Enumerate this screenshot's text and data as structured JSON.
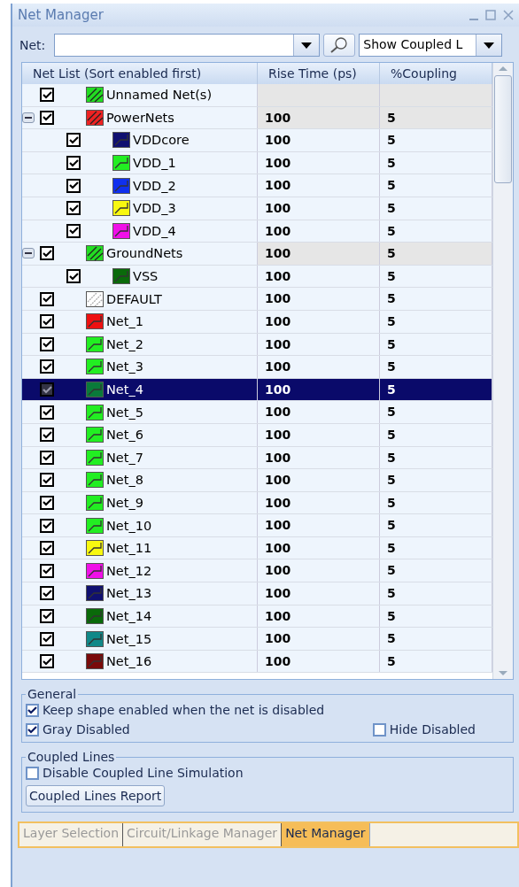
{
  "window": {
    "title": "Net Manager"
  },
  "toolbar": {
    "net_label": "Net:",
    "view_select": "Show Coupled L"
  },
  "columns": [
    "Net List (Sort enabled first)",
    "Rise Time (ps)",
    "%Coupling"
  ],
  "rows": [
    {
      "kind": "group",
      "name": "Unnamed Net(s)",
      "checked": true,
      "selected": false,
      "color": "#22dd22",
      "rise": "",
      "coupling": ""
    },
    {
      "kind": "group",
      "name": "PowerNets",
      "checked": true,
      "selected": false,
      "expanded": true,
      "color": "#ee2222",
      "rise": "100",
      "coupling": "5",
      "children": [
        {
          "kind": "net",
          "name": "VDDcore",
          "checked": true,
          "selected": false,
          "color": "#101070",
          "rise": "100",
          "coupling": "5"
        },
        {
          "kind": "net",
          "name": "VDD_1",
          "checked": true,
          "selected": false,
          "color": "#22ee22",
          "rise": "100",
          "coupling": "5"
        },
        {
          "kind": "net",
          "name": "VDD_2",
          "checked": true,
          "selected": false,
          "color": "#1030ee",
          "rise": "100",
          "coupling": "5"
        },
        {
          "kind": "net",
          "name": "VDD_3",
          "checked": true,
          "selected": false,
          "color": "#f8f810",
          "rise": "100",
          "coupling": "5"
        },
        {
          "kind": "net",
          "name": "VDD_4",
          "checked": true,
          "selected": false,
          "color": "#f010e8",
          "rise": "100",
          "coupling": "5"
        }
      ]
    },
    {
      "kind": "group",
      "name": "GroundNets",
      "checked": true,
      "selected": false,
      "expanded": true,
      "color": "#22dd22",
      "rise": "100",
      "coupling": "5",
      "children": [
        {
          "kind": "net",
          "name": "VSS",
          "checked": true,
          "selected": false,
          "color": "#0a6a0a",
          "rise": "100",
          "coupling": "5"
        }
      ]
    },
    {
      "kind": "default",
      "name": "DEFAULT",
      "checked": true,
      "selected": false,
      "color": "#ffffff",
      "rise": "100",
      "coupling": "5"
    },
    {
      "kind": "net",
      "name": "Net_1",
      "checked": true,
      "selected": false,
      "color": "#ee1111",
      "rise": "100",
      "coupling": "5"
    },
    {
      "kind": "net",
      "name": "Net_2",
      "checked": true,
      "selected": false,
      "color": "#22ee22",
      "rise": "100",
      "coupling": "5"
    },
    {
      "kind": "net",
      "name": "Net_3",
      "checked": true,
      "selected": false,
      "color": "#22ee22",
      "rise": "100",
      "coupling": "5"
    },
    {
      "kind": "net",
      "name": "Net_4",
      "checked": true,
      "selected": true,
      "color": "#0a7a3a",
      "rise": "100",
      "coupling": "5"
    },
    {
      "kind": "net",
      "name": "Net_5",
      "checked": true,
      "selected": false,
      "color": "#22ee22",
      "rise": "100",
      "coupling": "5"
    },
    {
      "kind": "net",
      "name": "Net_6",
      "checked": true,
      "selected": false,
      "color": "#22ee22",
      "rise": "100",
      "coupling": "5"
    },
    {
      "kind": "net",
      "name": "Net_7",
      "checked": true,
      "selected": false,
      "color": "#22ee22",
      "rise": "100",
      "coupling": "5"
    },
    {
      "kind": "net",
      "name": "Net_8",
      "checked": true,
      "selected": false,
      "color": "#22ee22",
      "rise": "100",
      "coupling": "5"
    },
    {
      "kind": "net",
      "name": "Net_9",
      "checked": true,
      "selected": false,
      "color": "#22ee22",
      "rise": "100",
      "coupling": "5"
    },
    {
      "kind": "net",
      "name": "Net_10",
      "checked": true,
      "selected": false,
      "color": "#22ee22",
      "rise": "100",
      "coupling": "5"
    },
    {
      "kind": "net",
      "name": "Net_11",
      "checked": true,
      "selected": false,
      "color": "#f8f810",
      "rise": "100",
      "coupling": "5"
    },
    {
      "kind": "net",
      "name": "Net_12",
      "checked": true,
      "selected": false,
      "color": "#f010e8",
      "rise": "100",
      "coupling": "5"
    },
    {
      "kind": "net",
      "name": "Net_13",
      "checked": true,
      "selected": false,
      "color": "#101070",
      "rise": "100",
      "coupling": "5"
    },
    {
      "kind": "net",
      "name": "Net_14",
      "checked": true,
      "selected": false,
      "color": "#0a6a0a",
      "rise": "100",
      "coupling": "5"
    },
    {
      "kind": "net",
      "name": "Net_15",
      "checked": true,
      "selected": false,
      "color": "#108888",
      "rise": "100",
      "coupling": "5"
    },
    {
      "kind": "net",
      "name": "Net_16",
      "checked": true,
      "selected": false,
      "color": "#7a0a0a",
      "rise": "100",
      "coupling": "5"
    }
  ],
  "general": {
    "title": "General",
    "options": [
      {
        "label": "Keep shape enabled when the net is disabled",
        "checked": true
      },
      {
        "label": "Gray Disabled",
        "checked": true
      },
      {
        "label": "Hide Disabled",
        "checked": false
      }
    ]
  },
  "coupled": {
    "title": "Coupled Lines",
    "option": {
      "label": "Disable Coupled Line Simulation",
      "checked": false
    },
    "button": "Coupled Lines Report"
  },
  "tabs": [
    {
      "label": "Layer Selection",
      "selected": false
    },
    {
      "label": "Circuit/Linkage Manager",
      "selected": false
    },
    {
      "label": "Net Manager",
      "selected": true
    }
  ]
}
